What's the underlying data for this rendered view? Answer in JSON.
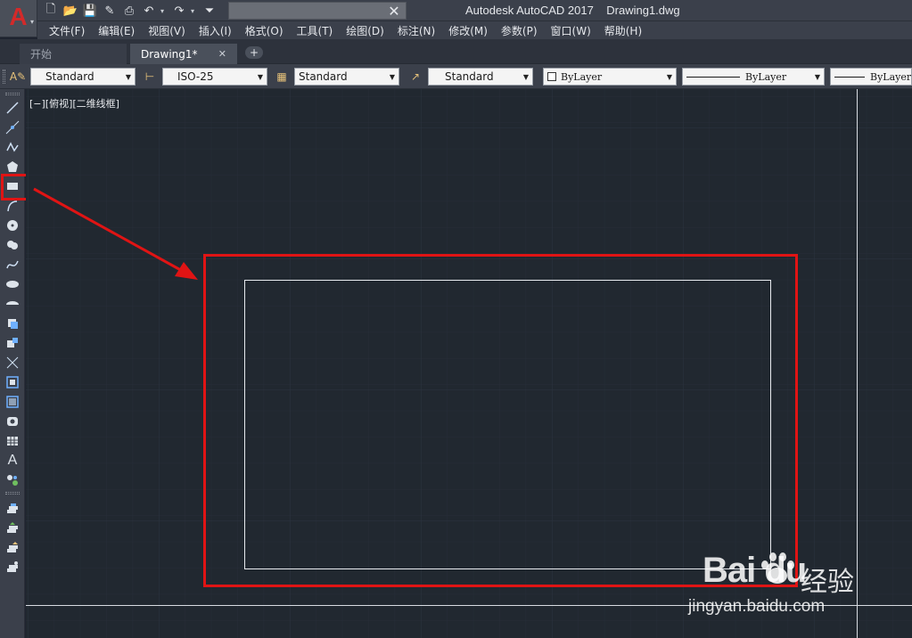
{
  "window": {
    "title": "Autodesk AutoCAD 2017    Drawing1.dwg",
    "logo_letter": "A"
  },
  "quick_access": [
    "new-icon",
    "open-icon",
    "save-icon",
    "save-as-icon",
    "plot-icon",
    "undo-icon",
    "redo-icon",
    "customize-icon"
  ],
  "menu": {
    "items": [
      {
        "label": "文件(F)"
      },
      {
        "label": "编辑(E)"
      },
      {
        "label": "视图(V)"
      },
      {
        "label": "插入(I)"
      },
      {
        "label": "格式(O)"
      },
      {
        "label": "工具(T)"
      },
      {
        "label": "绘图(D)"
      },
      {
        "label": "标注(N)"
      },
      {
        "label": "修改(M)"
      },
      {
        "label": "参数(P)"
      },
      {
        "label": "窗口(W)"
      },
      {
        "label": "帮助(H)"
      }
    ]
  },
  "tabs": {
    "start": "开始",
    "drawing": "Drawing1*",
    "close_glyph": "✕",
    "add_glyph": "+"
  },
  "styles_toolbar": {
    "text_style": "Standard",
    "dim_style": "ISO-25",
    "table_style": "Standard",
    "multileader_style": "Standard",
    "color": "ByLayer",
    "linetype": "ByLayer",
    "lineweight": "ByLayer"
  },
  "draw_tools": [
    "line-icon",
    "construction-line-icon",
    "polyline-icon",
    "polygon-icon",
    "rectangle-icon",
    "arc-icon",
    "circle-icon",
    "revision-cloud-icon",
    "spline-icon",
    "ellipse-icon",
    "ellipse-arc-icon",
    "insert-block-icon",
    "make-block-icon",
    "point-icon",
    "hatch-icon",
    "gradient-icon",
    "region-icon",
    "table-icon",
    "multiline-text-icon",
    "add-selected-icon",
    "layer-tool-1-icon",
    "layer-tool-2-icon",
    "layer-tool-3-icon",
    "layer-tool-4-icon"
  ],
  "canvas": {
    "view_label": "[−][俯视][二维线框]"
  },
  "watermark": {
    "logo": "Bai  du",
    "cn": "经验",
    "url": "jingyan.baidu.com"
  },
  "colors": {
    "background": "#212830",
    "annotation": "#e01414",
    "geometry": "#e8ebef",
    "brand": "#d32a2a"
  }
}
